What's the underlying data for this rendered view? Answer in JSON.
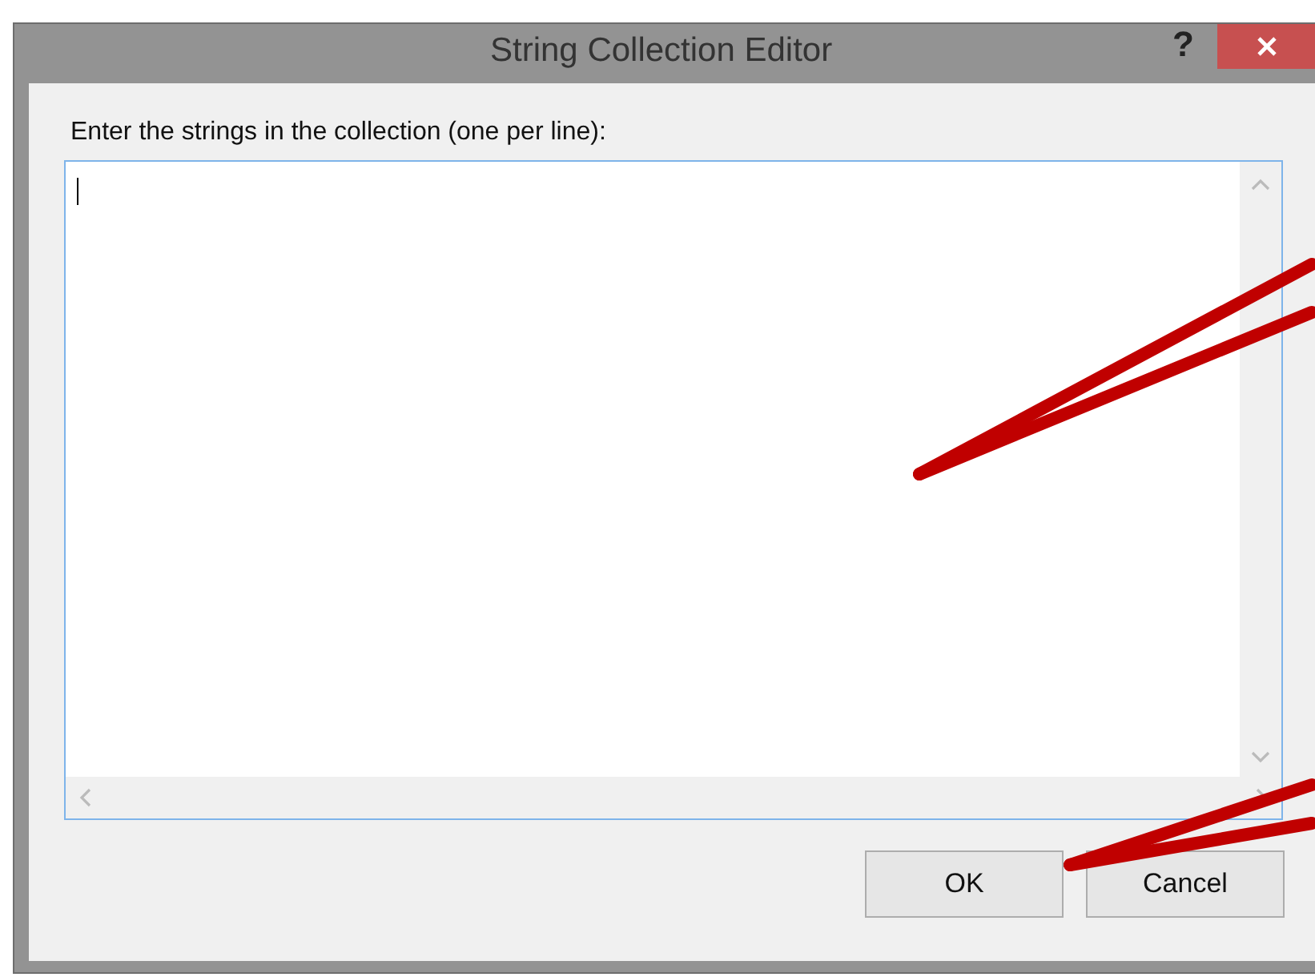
{
  "window": {
    "title": "String Collection Editor",
    "help": "?"
  },
  "prompt": "Enter the strings in the collection (one per line):",
  "buttons": [
    "OK",
    "Cancel"
  ],
  "callouts": [
    {
      "kind": "pointer"
    },
    {
      "kind": "pointer"
    }
  ]
}
